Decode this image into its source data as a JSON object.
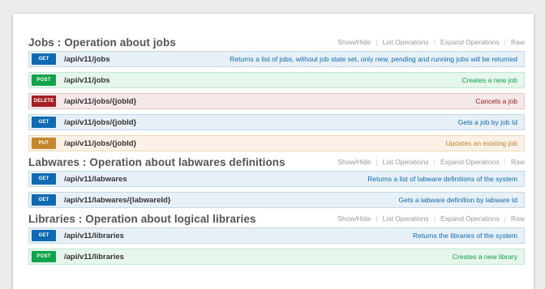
{
  "sections": [
    {
      "title": "Jobs : Operation about jobs",
      "links": [
        "Show/Hide",
        "List Operations",
        "Expand Operations",
        "Raw"
      ],
      "rows": [
        {
          "verb": "GET",
          "path": "/api/v11/jobs",
          "desc": "Returns a list of jobs, without job state set, only new, pending and running jobs will be returned"
        },
        {
          "verb": "POST",
          "path": "/api/v11/jobs",
          "desc": "Creates a new job"
        },
        {
          "verb": "DELETE",
          "path": "/api/v11/jobs/{jobId}",
          "desc": "Cancels a job"
        },
        {
          "verb": "GET",
          "path": "/api/v11/jobs/{jobId}",
          "desc": "Gets a job by job Id"
        },
        {
          "verb": "PUT",
          "path": "/api/v11/jobs/{jobId}",
          "desc": "Updates an existing job"
        }
      ]
    },
    {
      "title": "Labwares : Operation about labwares definitions",
      "links": [
        "Show/Hide",
        "List Operations",
        "Expand Operations",
        "Raw"
      ],
      "rows": [
        {
          "verb": "GET",
          "path": "/api/v11/labwares",
          "desc": "Returns a list of labware definitions of the system"
        },
        {
          "verb": "GET",
          "path": "/api/v11/labwares/{labwareId}",
          "desc": "Gets a labware definition by labware Id"
        }
      ]
    },
    {
      "title": "Libraries : Operation about logical libraries",
      "links": [
        "Show/Hide",
        "List Operations",
        "Expand Operations",
        "Raw"
      ],
      "rows": [
        {
          "verb": "GET",
          "path": "/api/v11/libraries",
          "desc": "Returns the libraries of the system"
        },
        {
          "verb": "POST",
          "path": "/api/v11/libraries",
          "desc": "Creates a new library"
        }
      ]
    }
  ],
  "colors": {
    "get": "#0f6ab4",
    "post": "#10a54a",
    "delete": "#a41e22",
    "put": "#c5862b"
  }
}
